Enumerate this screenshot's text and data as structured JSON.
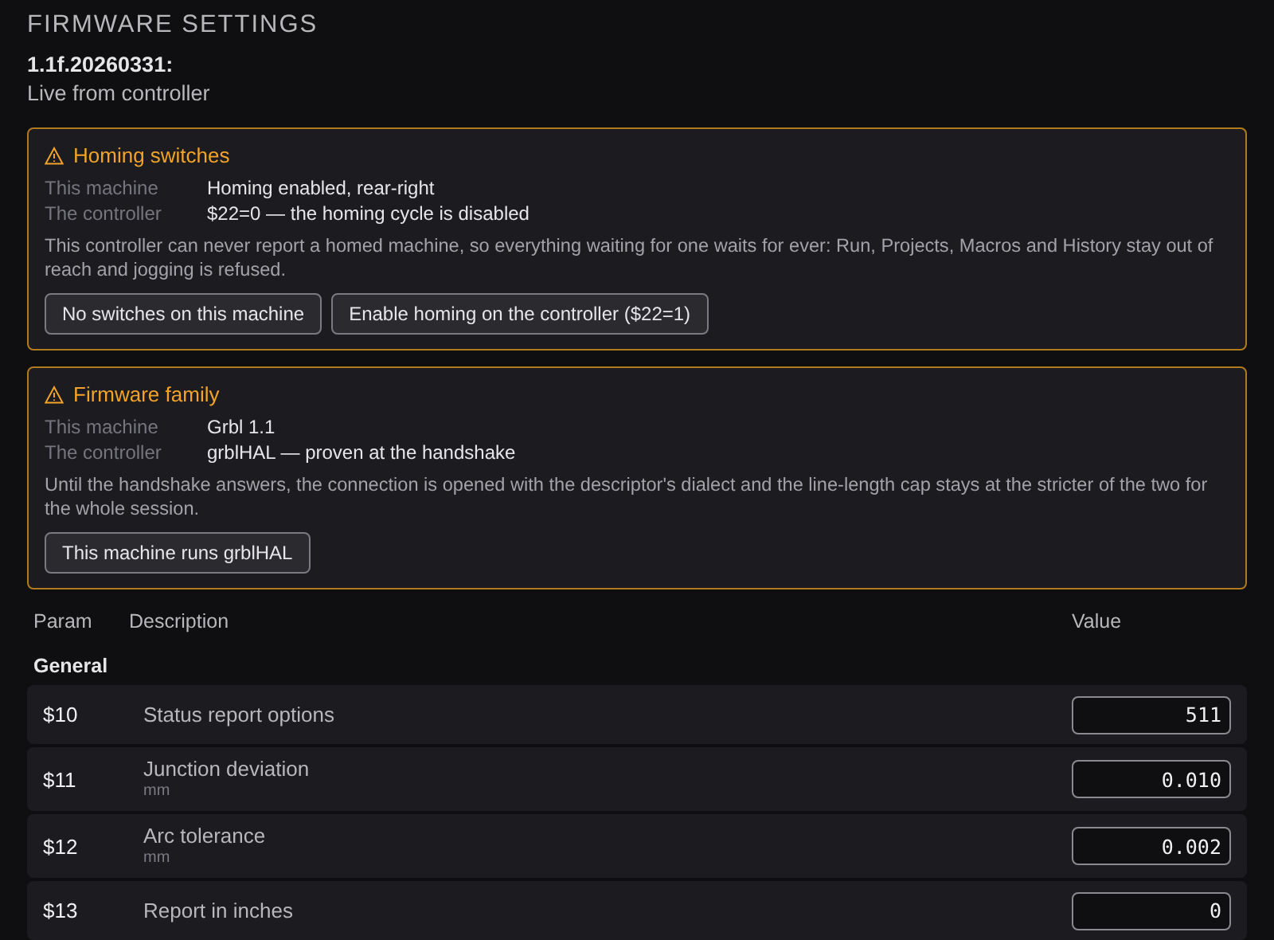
{
  "title": "FIRMWARE SETTINGS",
  "version": "1.1f.20260331:",
  "source": "Live from controller",
  "warnings": [
    {
      "kind": "warning",
      "title": "Homing switches",
      "facts": [
        {
          "label": "This machine",
          "value": "Homing enabled, rear-right"
        },
        {
          "label": "The controller",
          "value": "$22=0 — the homing cycle is disabled"
        }
      ],
      "text": "This controller can never report a homed machine, so everything waiting for one waits for ever: Run, Projects, Macros and History stay out of reach and jogging is refused.",
      "actions": [
        "No switches on this machine",
        "Enable homing on the controller ($22=1)"
      ]
    },
    {
      "kind": "warning",
      "title": "Firmware family",
      "facts": [
        {
          "label": "This machine",
          "value": "Grbl 1.1"
        },
        {
          "label": "The controller",
          "value": "grblHAL — proven at the handshake"
        }
      ],
      "text": "Until the handshake answers, the connection is opened with the descriptor's dialect and the line-length cap stays at the stricter of the two for the whole session.",
      "actions": [
        "This machine runs grblHAL"
      ]
    }
  ],
  "table": {
    "columns": [
      "Param",
      "Description",
      "Value"
    ],
    "group": "General",
    "rows": [
      {
        "param": "$10",
        "description": "Status report options",
        "value": "511"
      },
      {
        "param": "$11",
        "description": "Junction deviation",
        "unit": "mm",
        "value": "0.010"
      },
      {
        "param": "$12",
        "description": "Arc tolerance",
        "unit": "mm",
        "value": "0.002"
      },
      {
        "param": "$13",
        "description": "Report in inches",
        "value": "0"
      }
    ]
  }
}
